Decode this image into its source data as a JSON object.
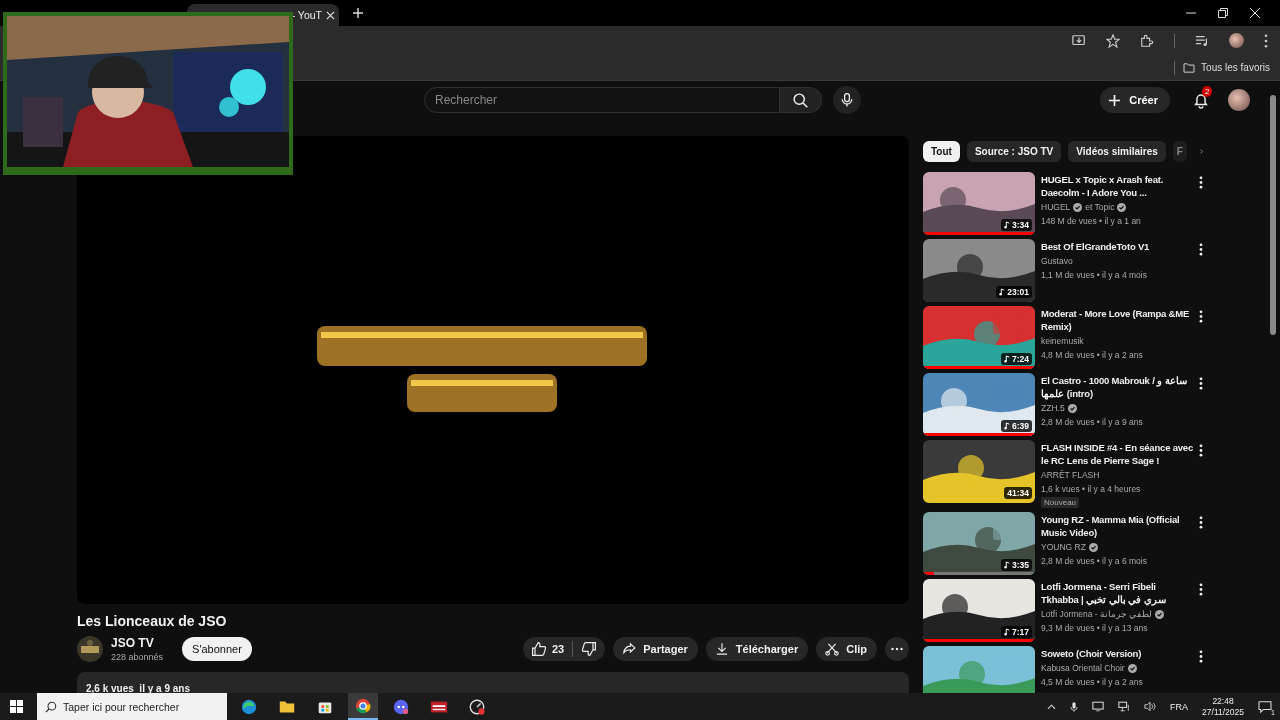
{
  "browser": {
    "tabs": [
      {
        "title": "- YouT",
        "selected": true
      }
    ],
    "bookmarks": [
      {
        "label": "Tous les favoris"
      }
    ]
  },
  "header": {
    "search": {
      "placeholder": "Rechercher"
    },
    "create": "Créer",
    "notifications": "2"
  },
  "video": {
    "title": "Les Lionceaux de JSO",
    "channel": "JSO TV",
    "subscribers": "228 abonnés",
    "subscribe": "S'abonner",
    "likes": "23",
    "actions": [
      {
        "kind": "share",
        "label": "Partager"
      },
      {
        "kind": "download",
        "label": "Télécharger"
      },
      {
        "kind": "clip",
        "label": "Clip"
      }
    ],
    "description": "2,6 k vues  il y a 9 ans"
  },
  "chips": [
    {
      "label": "Tout",
      "selected": true
    },
    {
      "label": "Source : JSO TV",
      "selected": false
    },
    {
      "label": "Vidéos similaires",
      "selected": false
    },
    {
      "label": "F",
      "selected": false
    }
  ],
  "recommendations": [
    {
      "title": "HUGEL x Topic x Arash feat. Daecolm - I Adore You ...",
      "channels": [
        {
          "name": "HUGEL",
          "verified": true
        },
        {
          "name": "et Topic",
          "verified": true
        }
      ],
      "meta": "148 M de vues • il y a 1 an",
      "duration": "3:34",
      "music": true,
      "level": 1
    },
    {
      "title": "Best Of ElGrandeToto V1",
      "channels": [
        {
          "name": "Gustavo",
          "verified": false
        }
      ],
      "meta": "1,1 M de vues • il y a 4 mois",
      "duration": "23:01",
      "music": true
    },
    {
      "title": "Moderat - More Love (Rampa &ME Remix)",
      "channels": [
        {
          "name": "keinemusik",
          "verified": false
        }
      ],
      "meta": "4,8 M de vues • il y a 2 ans",
      "duration": "7:24",
      "music": true,
      "level": 1
    },
    {
      "title": "El Castro - 1000 Mabrouk / ساعة و علمها (intro)",
      "channels": [
        {
          "name": "ZZH.5",
          "verified": true
        }
      ],
      "meta": "2,8 M de vues • il y a 9 ans",
      "duration": "6:39",
      "music": true,
      "level": 1
    },
    {
      "title": "FLASH INSIDE #4 - En séance avec le RC Lens de Pierre Sage !",
      "channels": [
        {
          "name": "ARRÊT FLASH",
          "verified": false
        }
      ],
      "meta": "1,6 k vues • il y a 4 heures",
      "badge": "Nouveau",
      "duration": "41:34",
      "music": false
    },
    {
      "title": "Young RZ - Mamma Mia (Official Music Video)",
      "channels": [
        {
          "name": "YOUNG RZ",
          "verified": true
        }
      ],
      "meta": "2,8 M de vues • il y a 6 mois",
      "duration": "3:35",
      "music": true,
      "level": 0.1
    },
    {
      "title": "Lotfi Jormena - Serri Fibeli Tkhabba | سري في بالي تخبي",
      "channels": [
        {
          "name": "Lotfi Jormena - لطفي جرمانة",
          "verified": true
        }
      ],
      "meta": "9,3 M de vues • il y a 13 ans",
      "duration": "7:17",
      "music": true,
      "level": 1
    },
    {
      "title": "Soweto (Choir Version)",
      "channels": [
        {
          "name": "Kabusa Oriental Choir",
          "verified": true
        }
      ],
      "meta": "4,5 M de vues • il y a 2 ans"
    }
  ],
  "taskbar": {
    "search": {
      "placeholder": "Taper ici pour rechercher"
    },
    "apps": [
      {
        "kind": "edge",
        "selected": false
      },
      {
        "kind": "folder",
        "selected": false
      },
      {
        "kind": "store",
        "selected": false
      },
      {
        "kind": "chrome",
        "selected": true
      },
      {
        "kind": "chat",
        "selected": false
      },
      {
        "kind": "mixer",
        "selected": false
      },
      {
        "kind": "gauge",
        "selected": false
      }
    ],
    "language": "FRA",
    "time": "22:48",
    "date": "27/11/2025",
    "notifications": "1"
  }
}
